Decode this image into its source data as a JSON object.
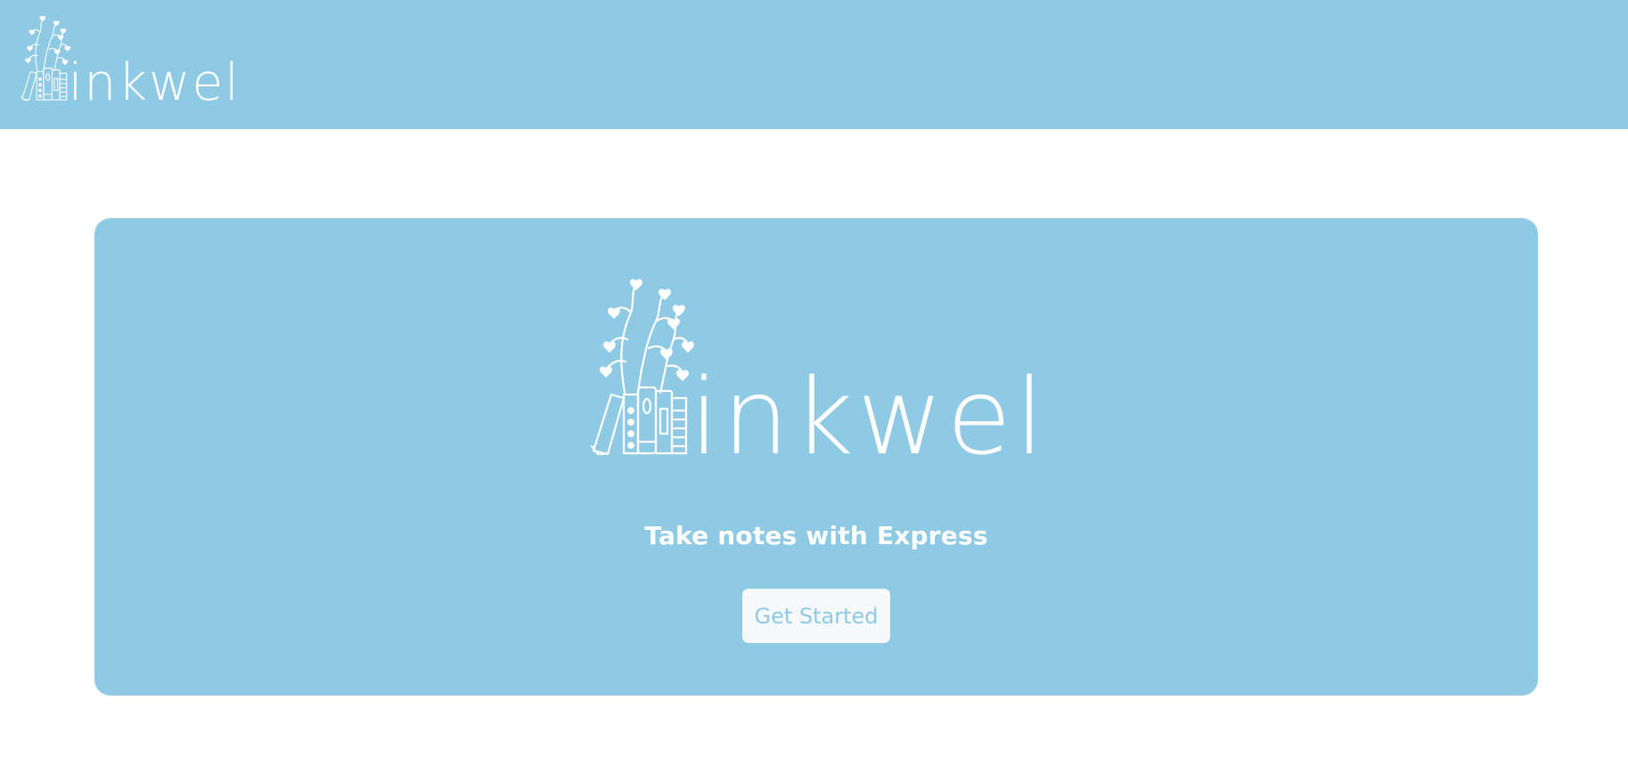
{
  "brand": {
    "name": "inkwel",
    "logo_icon": "books-with-heart-vines-icon"
  },
  "hero": {
    "tagline": "Take notes with Express",
    "cta_label": "Get Started"
  },
  "colors": {
    "primary": "#8fcae5",
    "button_bg": "#f6f8fa",
    "text_on_primary": "#ffffff"
  }
}
